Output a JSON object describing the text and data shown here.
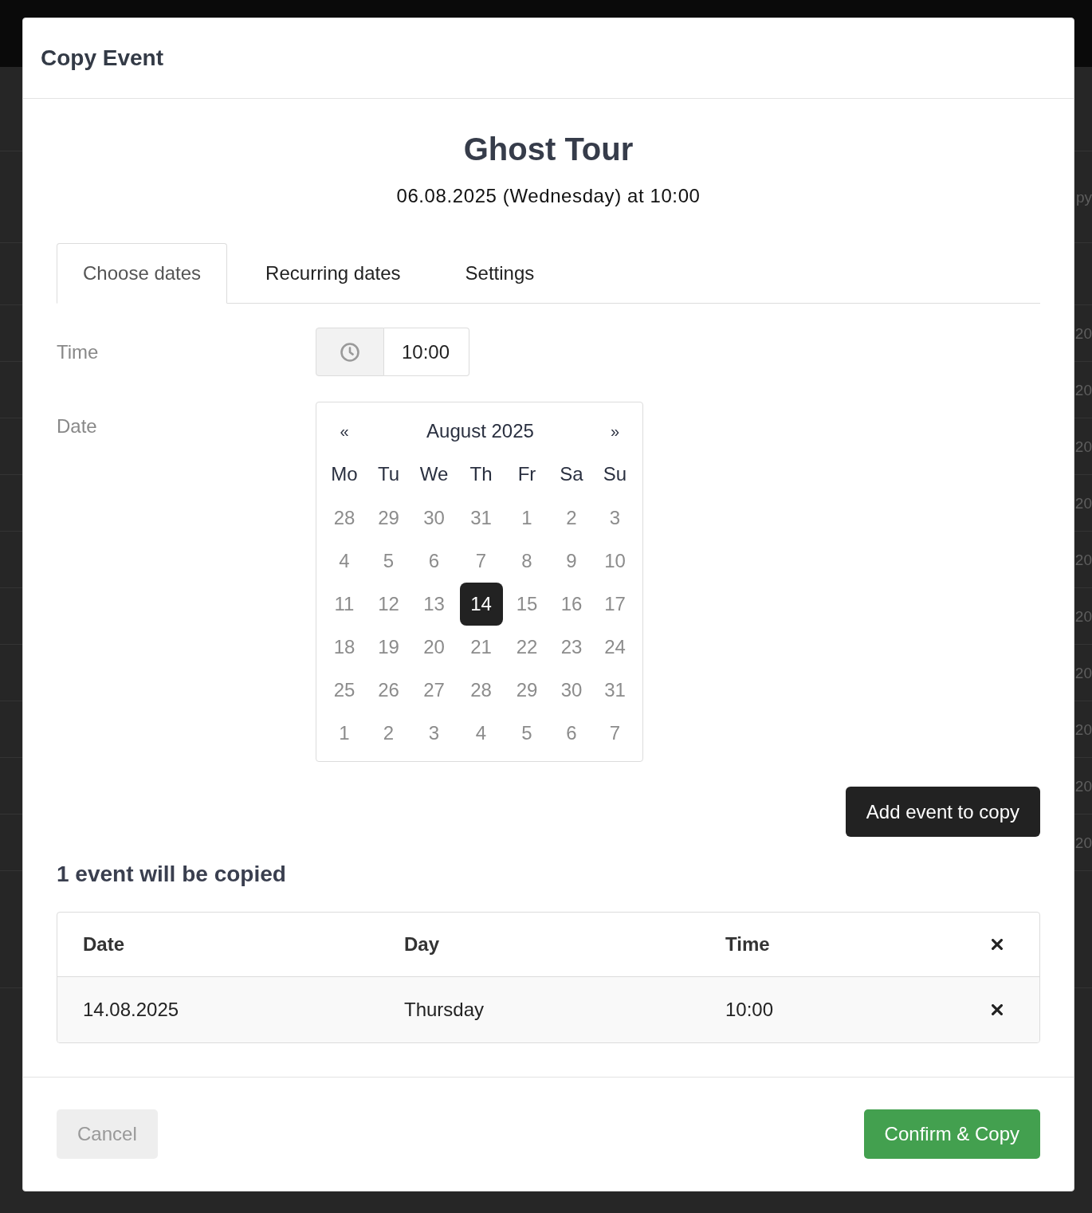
{
  "background_page": {
    "column_texts": [
      "py",
      "20",
      "20",
      "20",
      "20",
      "20",
      "20",
      "20",
      "20",
      "20",
      "20"
    ]
  },
  "dialog": {
    "title": "Copy Event",
    "event": {
      "name": "Ghost Tour",
      "when": "06.08.2025 (Wednesday) at 10:00"
    },
    "tabs": [
      {
        "label": "Choose dates",
        "selected": true
      },
      {
        "label": "Recurring dates",
        "selected": false
      },
      {
        "label": "Settings",
        "selected": false
      }
    ],
    "time": {
      "label": "Time",
      "value": "10:00"
    },
    "date": {
      "label": "Date",
      "calendar": {
        "prev": "«",
        "month": "August 2025",
        "next": "»",
        "weekdays": [
          "Mo",
          "Tu",
          "We",
          "Th",
          "Fr",
          "Sa",
          "Su"
        ],
        "weeks": [
          [
            {
              "day": "28",
              "selected": false
            },
            {
              "day": "29",
              "selected": false
            },
            {
              "day": "30",
              "selected": false
            },
            {
              "day": "31",
              "selected": false
            },
            {
              "day": "1",
              "selected": false
            },
            {
              "day": "2",
              "selected": false
            },
            {
              "day": "3",
              "selected": false
            }
          ],
          [
            {
              "day": "4",
              "selected": false
            },
            {
              "day": "5",
              "selected": false
            },
            {
              "day": "6",
              "selected": false
            },
            {
              "day": "7",
              "selected": false
            },
            {
              "day": "8",
              "selected": false
            },
            {
              "day": "9",
              "selected": false
            },
            {
              "day": "10",
              "selected": false
            }
          ],
          [
            {
              "day": "11",
              "selected": false
            },
            {
              "day": "12",
              "selected": false
            },
            {
              "day": "13",
              "selected": false
            },
            {
              "day": "14",
              "selected": true
            },
            {
              "day": "15",
              "selected": false
            },
            {
              "day": "16",
              "selected": false
            },
            {
              "day": "17",
              "selected": false
            }
          ],
          [
            {
              "day": "18",
              "selected": false
            },
            {
              "day": "19",
              "selected": false
            },
            {
              "day": "20",
              "selected": false
            },
            {
              "day": "21",
              "selected": false
            },
            {
              "day": "22",
              "selected": false
            },
            {
              "day": "23",
              "selected": false
            },
            {
              "day": "24",
              "selected": false
            }
          ],
          [
            {
              "day": "25",
              "selected": false
            },
            {
              "day": "26",
              "selected": false
            },
            {
              "day": "27",
              "selected": false
            },
            {
              "day": "28",
              "selected": false
            },
            {
              "day": "29",
              "selected": false
            },
            {
              "day": "30",
              "selected": false
            },
            {
              "day": "31",
              "selected": false
            }
          ],
          [
            {
              "day": "1",
              "selected": false
            },
            {
              "day": "2",
              "selected": false
            },
            {
              "day": "3",
              "selected": false
            },
            {
              "day": "4",
              "selected": false
            },
            {
              "day": "5",
              "selected": false
            },
            {
              "day": "6",
              "selected": false
            },
            {
              "day": "7",
              "selected": false
            }
          ]
        ]
      }
    },
    "add_button": "Add event to copy",
    "summary": "1 event will be copied",
    "table": {
      "columns": [
        "Date",
        "Day",
        "Time"
      ],
      "rows": [
        {
          "cells": [
            "14.08.2025",
            "Thursday",
            "10:00"
          ]
        }
      ]
    },
    "footer": {
      "cancel": "Cancel",
      "confirm": "Confirm & Copy"
    }
  }
}
